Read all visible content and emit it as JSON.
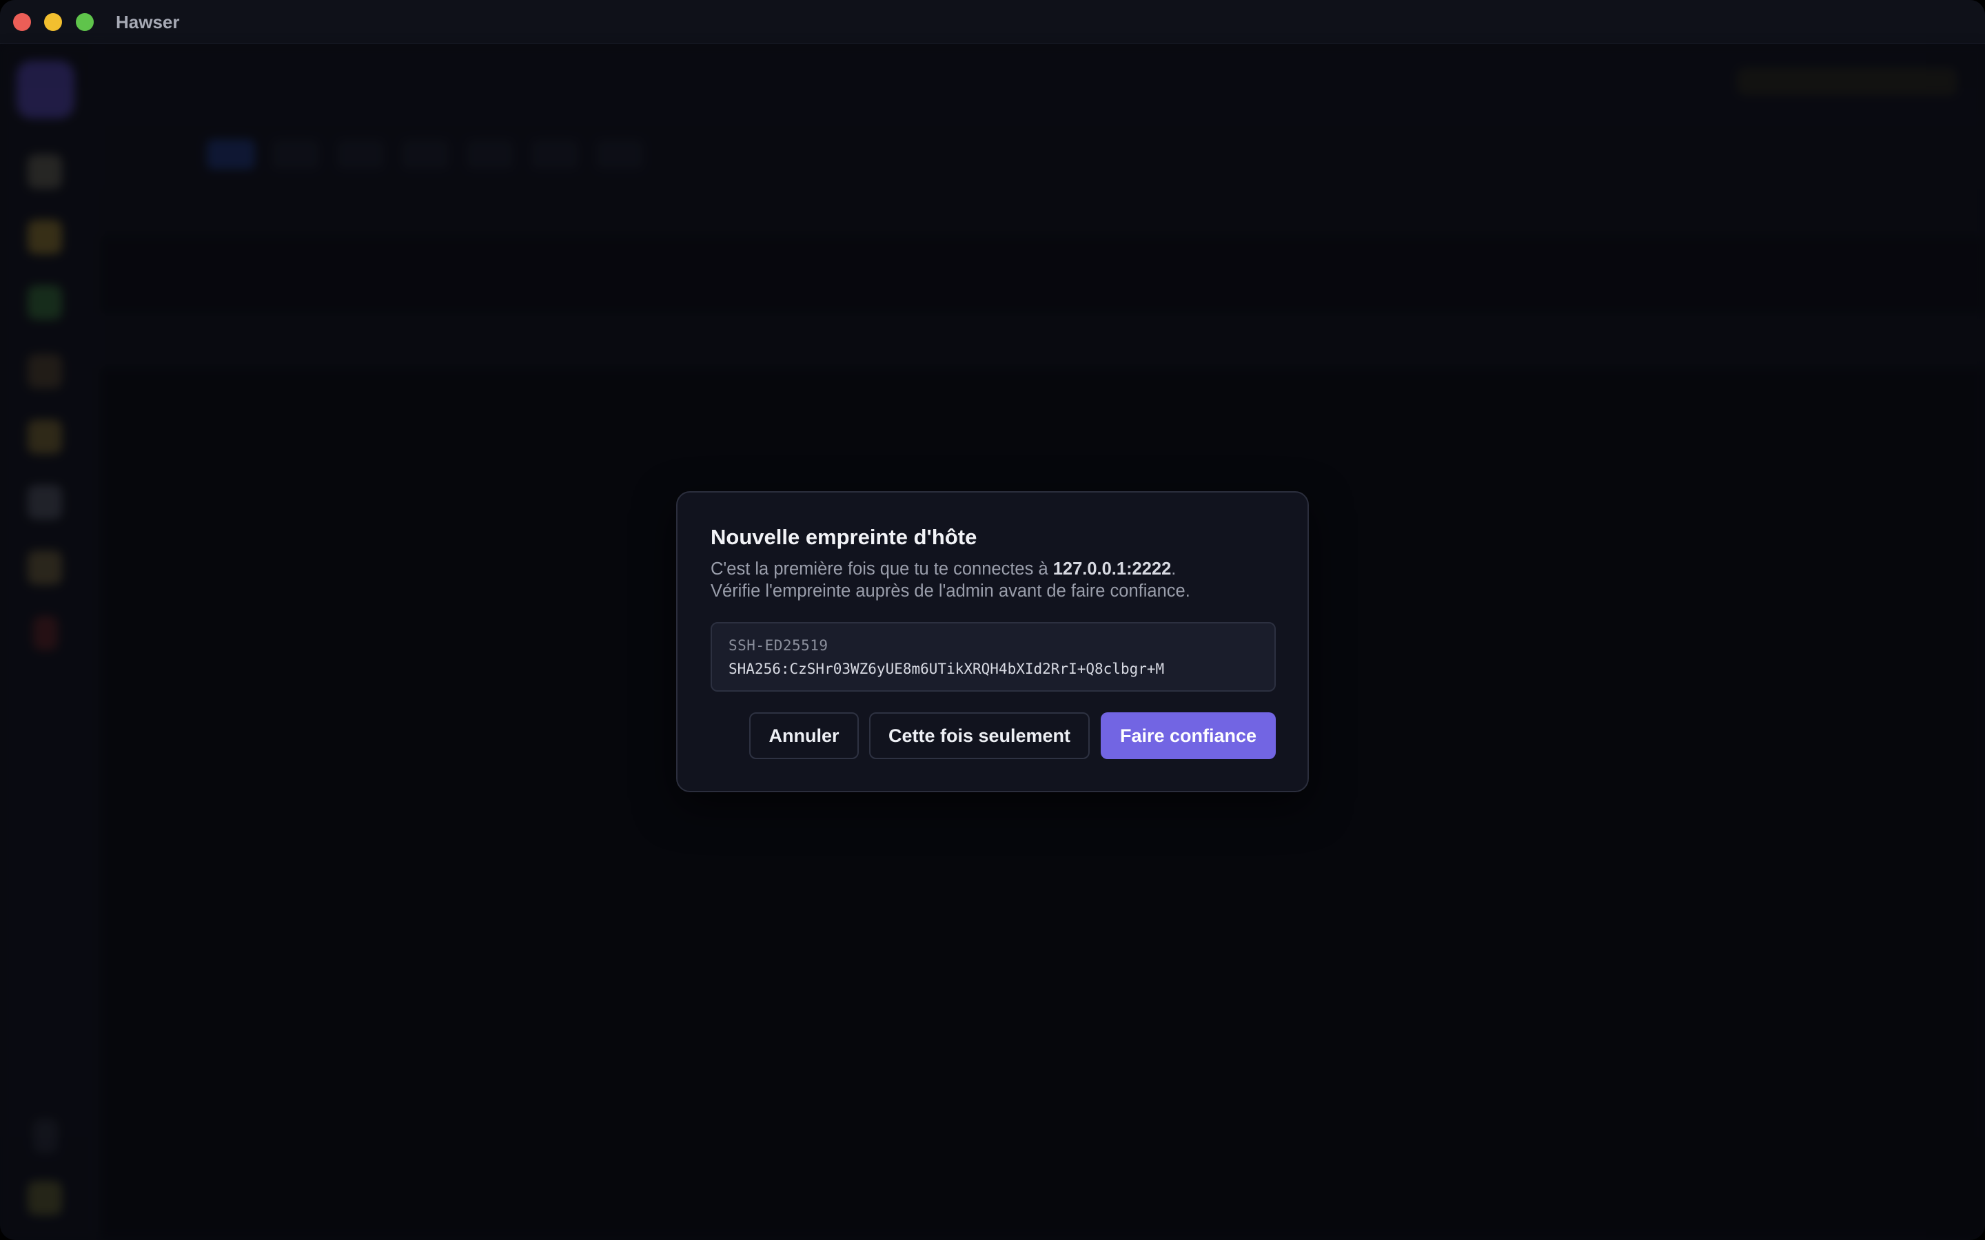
{
  "window": {
    "app_title": "Hawser",
    "controls": [
      "close",
      "minimize",
      "zoom"
    ]
  },
  "dialog": {
    "title": "Nouvelle empreinte d'hôte",
    "desc_prefix": "C'est la première fois que tu te connectes à ",
    "host": "127.0.0.1:2222",
    "desc_suffix": ".",
    "desc_line2": "Vérifie l'empreinte auprès de l'admin avant de faire confiance.",
    "fingerprint": {
      "algorithm": "SSH-ED25519",
      "hash": "SHA256:CzSHr03WZ6yUE8m6UTikXRQH4bXId2RrI+Q8clbgr+M"
    },
    "buttons": {
      "cancel": "Annuler",
      "once": "Cette fois seulement",
      "trust": "Faire confiance"
    }
  },
  "colors": {
    "accent": "#7265e3",
    "background": "#0b0d15",
    "dialog_bg": "#11131e"
  }
}
